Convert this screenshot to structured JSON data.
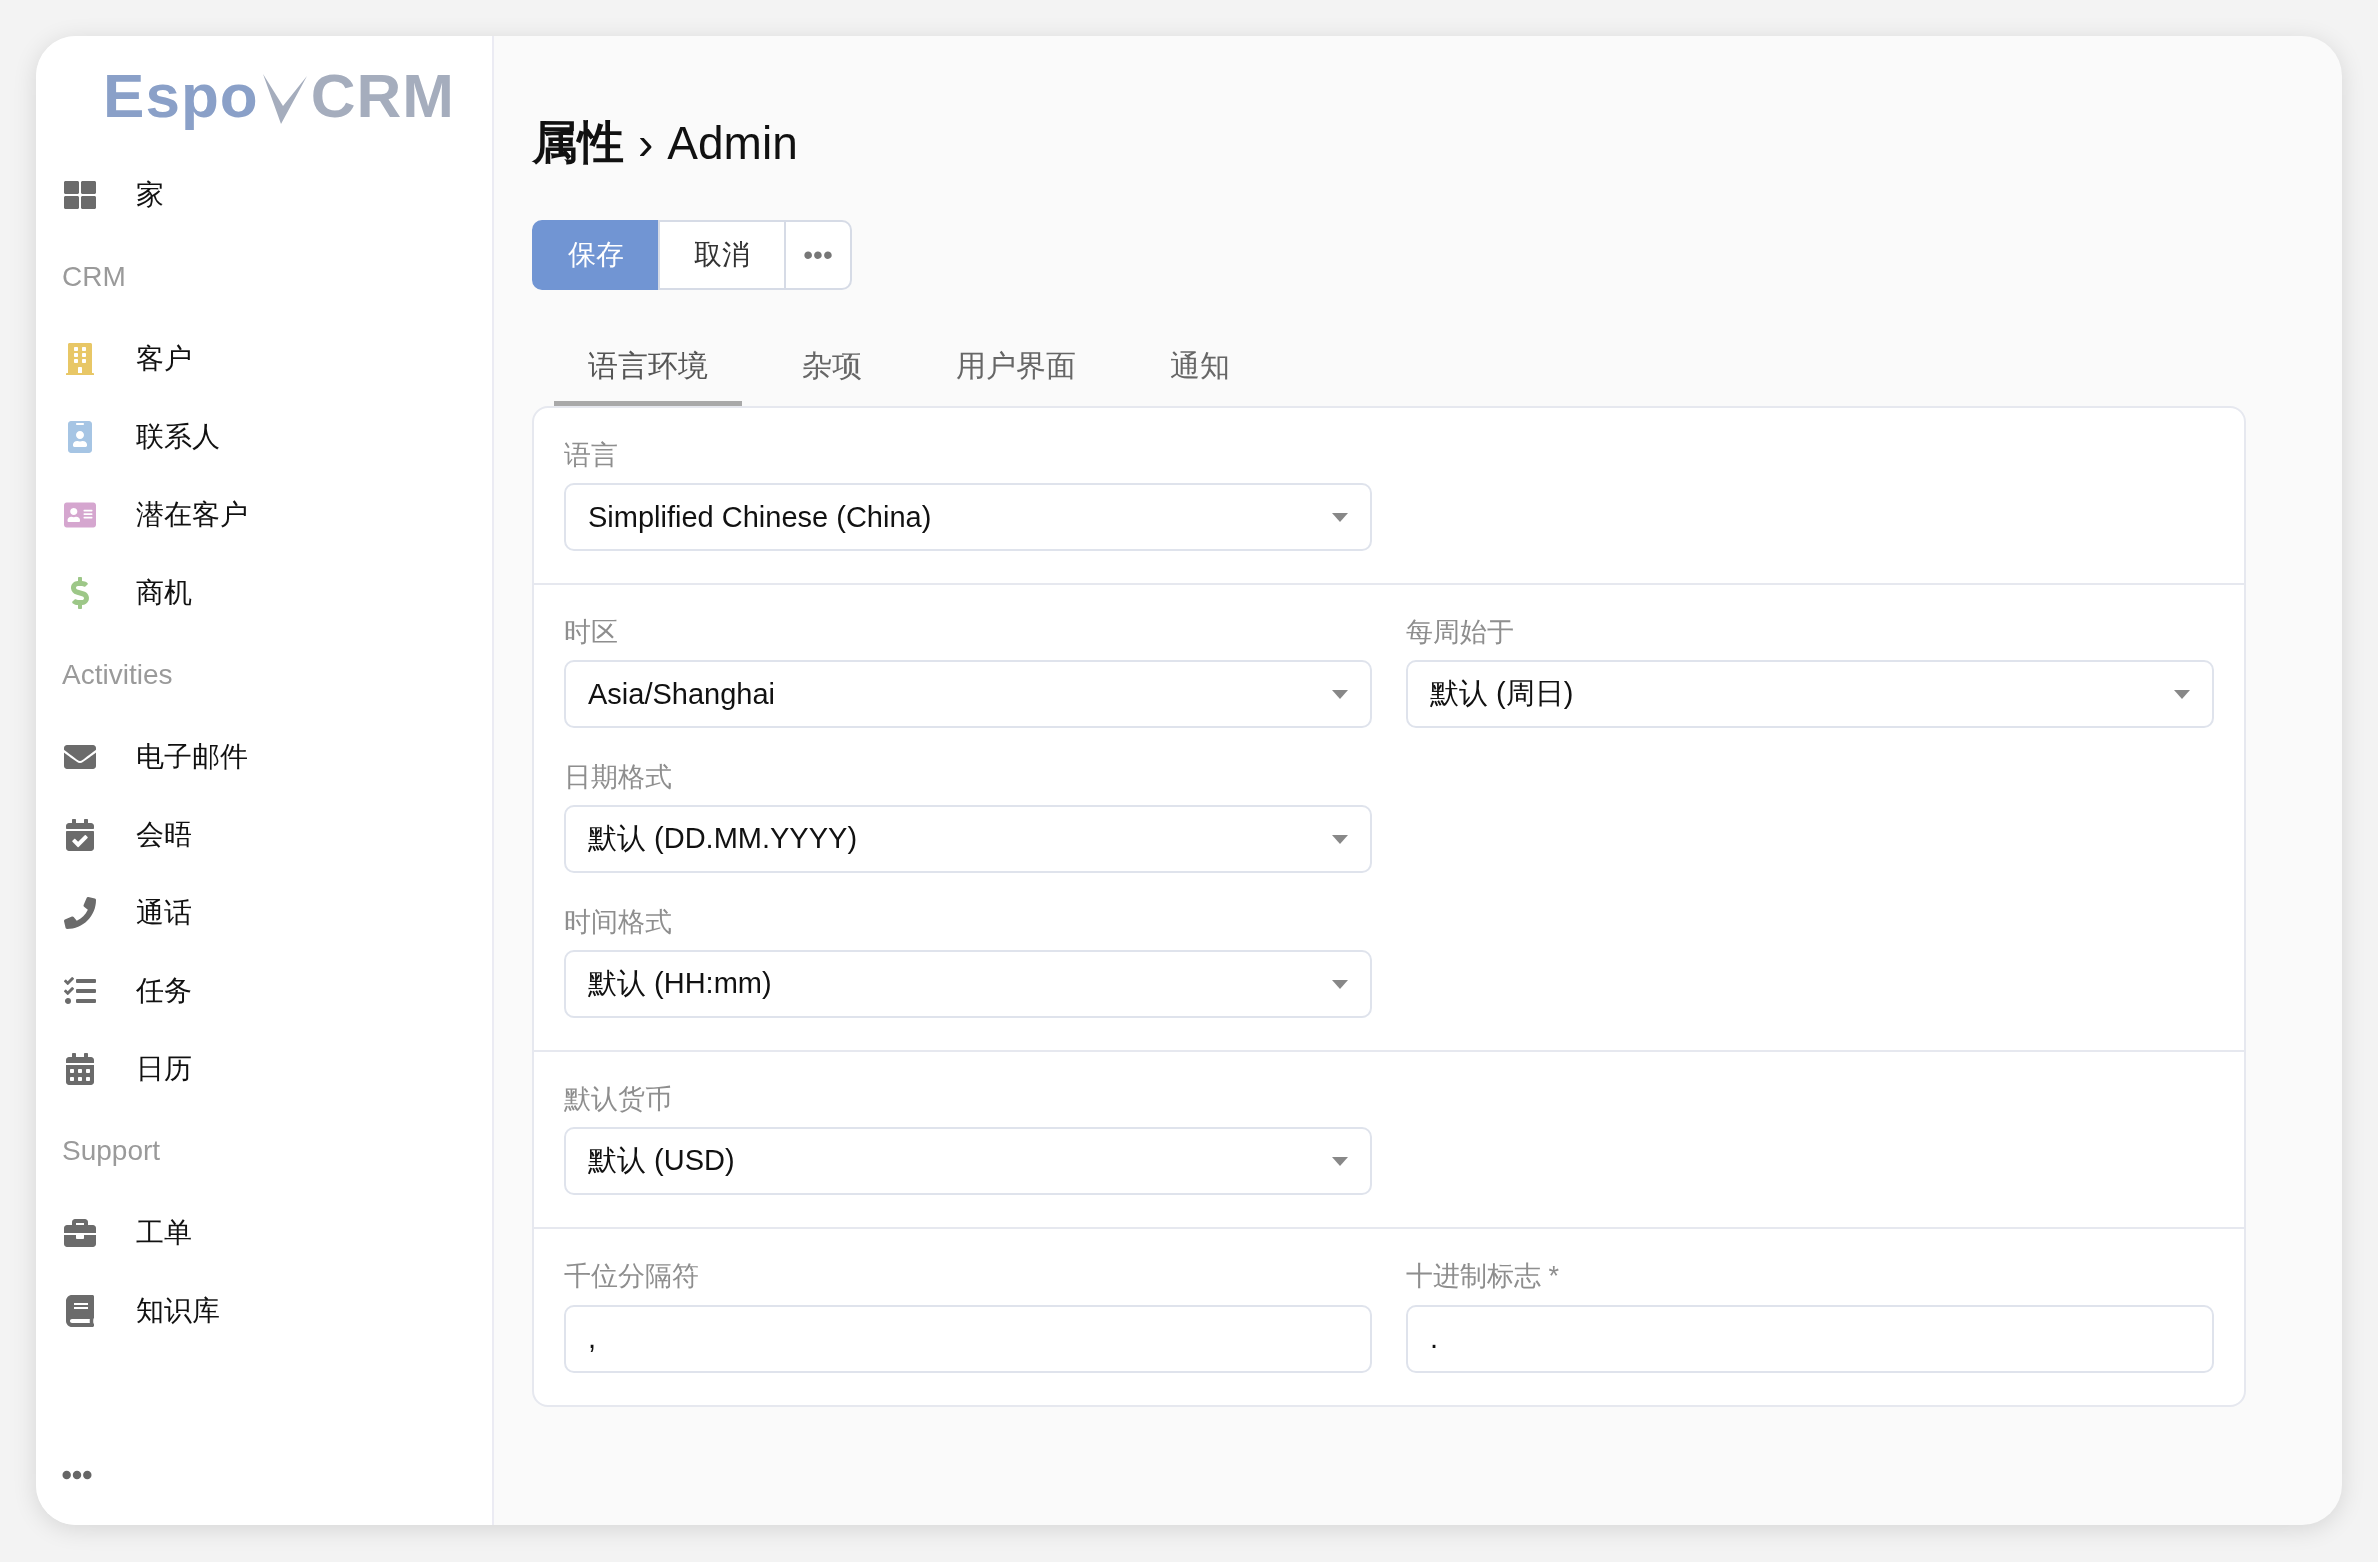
{
  "logo": {
    "left": "Espo",
    "right": "CRM"
  },
  "sidebar": {
    "groups": [
      {
        "items": [
          {
            "label": "家",
            "kind": "home",
            "color": "#6b6b6b"
          }
        ]
      },
      {
        "label": "CRM",
        "items": [
          {
            "label": "客户",
            "kind": "account",
            "color": "#e8c766"
          },
          {
            "label": "联系人",
            "kind": "contact",
            "color": "#a6c5e4"
          },
          {
            "label": "潜在客户",
            "kind": "lead",
            "color": "#d5a6cf"
          },
          {
            "label": "商机",
            "kind": "opportunity",
            "color": "#9dc788"
          }
        ]
      },
      {
        "label": "Activities",
        "items": [
          {
            "label": "电子邮件",
            "kind": "email",
            "color": "#6b6b6b"
          },
          {
            "label": "会晤",
            "kind": "meeting",
            "color": "#6b6b6b"
          },
          {
            "label": "通话",
            "kind": "call",
            "color": "#6b6b6b"
          },
          {
            "label": "任务",
            "kind": "task",
            "color": "#6b6b6b"
          },
          {
            "label": "日历",
            "kind": "calendar",
            "color": "#6b6b6b"
          }
        ]
      },
      {
        "label": "Support",
        "items": [
          {
            "label": "工单",
            "kind": "case",
            "color": "#6b6b6b"
          },
          {
            "label": "知识库",
            "kind": "knowledge",
            "color": "#6b6b6b"
          }
        ]
      }
    ]
  },
  "header": {
    "title": "属性",
    "separator": "›",
    "subtitle": "Admin"
  },
  "buttons": [
    {
      "label": "保存",
      "kind": "primary"
    },
    {
      "label": "取消",
      "kind": "default"
    },
    {
      "label": "•••",
      "kind": "more"
    }
  ],
  "tabs": [
    {
      "label": "语言环境",
      "selected": true
    },
    {
      "label": "杂项",
      "selected": false
    },
    {
      "label": "用户界面",
      "selected": false
    },
    {
      "label": "通知",
      "selected": false
    }
  ],
  "sections": [
    {
      "rows": [
        [
          {
            "label": "语言",
            "value": "Simplified Chinese (China)",
            "kind": "select"
          }
        ]
      ]
    },
    {
      "rows": [
        [
          {
            "label": "时区",
            "value": "Asia/Shanghai",
            "kind": "select"
          },
          {
            "label": "每周始于",
            "value": "默认 (周日)",
            "kind": "select"
          }
        ],
        [
          {
            "label": "日期格式",
            "value": "默认 (DD.MM.YYYY)",
            "kind": "select"
          }
        ],
        [
          {
            "label": "时间格式",
            "value": "默认 (HH:mm)",
            "kind": "select"
          }
        ]
      ]
    },
    {
      "rows": [
        [
          {
            "label": "默认货币",
            "value": "默认 (USD)",
            "kind": "select"
          }
        ]
      ]
    },
    {
      "rows": [
        [
          {
            "label": "千位分隔符",
            "value": ",",
            "kind": "text"
          },
          {
            "label": "十进制标志 *",
            "value": ".",
            "kind": "text"
          }
        ]
      ]
    }
  ]
}
